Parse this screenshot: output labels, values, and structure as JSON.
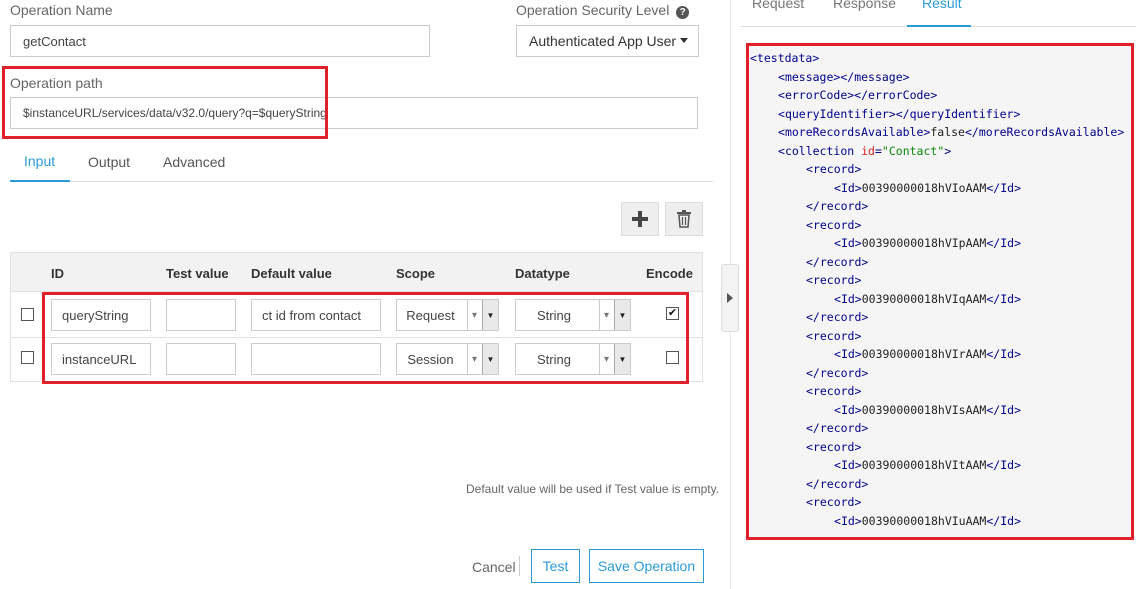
{
  "form": {
    "operation_name_label": "Operation Name",
    "operation_name_value": "getContact",
    "security_level_label": "Operation Security Level",
    "security_level_value": "Authenticated App User",
    "operation_path_label": "Operation path",
    "operation_path_value": "$instanceURL/services/data/v32.0/query?q=$queryString"
  },
  "tabs": [
    {
      "label": "Input",
      "active": true
    },
    {
      "label": "Output",
      "active": false
    },
    {
      "label": "Advanced",
      "active": false
    }
  ],
  "table": {
    "headers": [
      "ID",
      "Test value",
      "Default value",
      "Scope",
      "Datatype",
      "Encode"
    ],
    "rows": [
      {
        "checked": false,
        "id": "queryString",
        "test_value": "",
        "default_value": "ct id from contact",
        "scope": "Request",
        "datatype": "String",
        "encode": true
      },
      {
        "checked": false,
        "id": "instanceURL",
        "test_value": "",
        "default_value": "",
        "scope": "Session",
        "datatype": "String",
        "encode": false
      }
    ]
  },
  "hint": "Default value will be used if Test value is empty.",
  "actions": {
    "cancel": "Cancel",
    "test": "Test",
    "save": "Save Operation"
  },
  "right_tabs": [
    {
      "label": "Request",
      "active": false
    },
    {
      "label": "Response",
      "active": false
    },
    {
      "label": "Result",
      "active": true
    }
  ],
  "xml": {
    "root": "testdata",
    "message_tag": "message",
    "error_tag": "errorCode",
    "query_tag": "queryIdentifier",
    "more_tag": "moreRecordsAvailable",
    "more_value": "false",
    "collection_tag": "collection",
    "collection_attr": "id",
    "collection_attr_value": "Contact",
    "record_tag": "record",
    "id_tag": "Id",
    "record_ids": [
      "00390000018hVIoAAM",
      "00390000018hVIpAAM",
      "00390000018hVIqAAM",
      "00390000018hVIrAAM",
      "00390000018hVIsAAM",
      "00390000018hVItAAM",
      "00390000018hVIuAAM"
    ]
  },
  "colors": {
    "accent": "#2b9bd6",
    "highlight": "#e0202a"
  }
}
